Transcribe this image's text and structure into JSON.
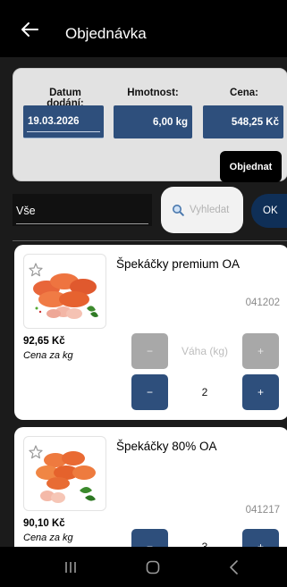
{
  "header": {
    "title": "Objednávka",
    "back_icon": "arrow-left-icon"
  },
  "summary": {
    "date_label": "Datum dodání:",
    "date_value": "19.03.2026",
    "weight_label": "Hmotnost:",
    "weight_value": "6,00 kg",
    "price_label": "Cena:",
    "price_value": "548,25 Kč",
    "order_button": "Objednat"
  },
  "filter": {
    "category_value": "Vše",
    "search_placeholder": "Vyhledat",
    "ok_button": "OK"
  },
  "products": [
    {
      "name": "Špekáčky premium OA",
      "code": "041202",
      "price": "92,65 Kč",
      "unit": "Cena za kg",
      "weight_label": "Váha (kg)",
      "minus": "−",
      "plus": "+",
      "quantity": "2"
    },
    {
      "name": "Špekáčky 80% OA",
      "code": "041217",
      "price": "90,10 Kč",
      "unit": "Cena za kg",
      "minus": "−",
      "plus": "+",
      "quantity": "3"
    }
  ],
  "colors": {
    "accent": "#2e4f7c",
    "ok_button": "#0f2f57",
    "panel": "#e2e2e2",
    "disabled": "#a8a8a8"
  },
  "nav": {
    "icons": [
      "recent-apps-icon",
      "home-icon",
      "back-icon"
    ]
  }
}
